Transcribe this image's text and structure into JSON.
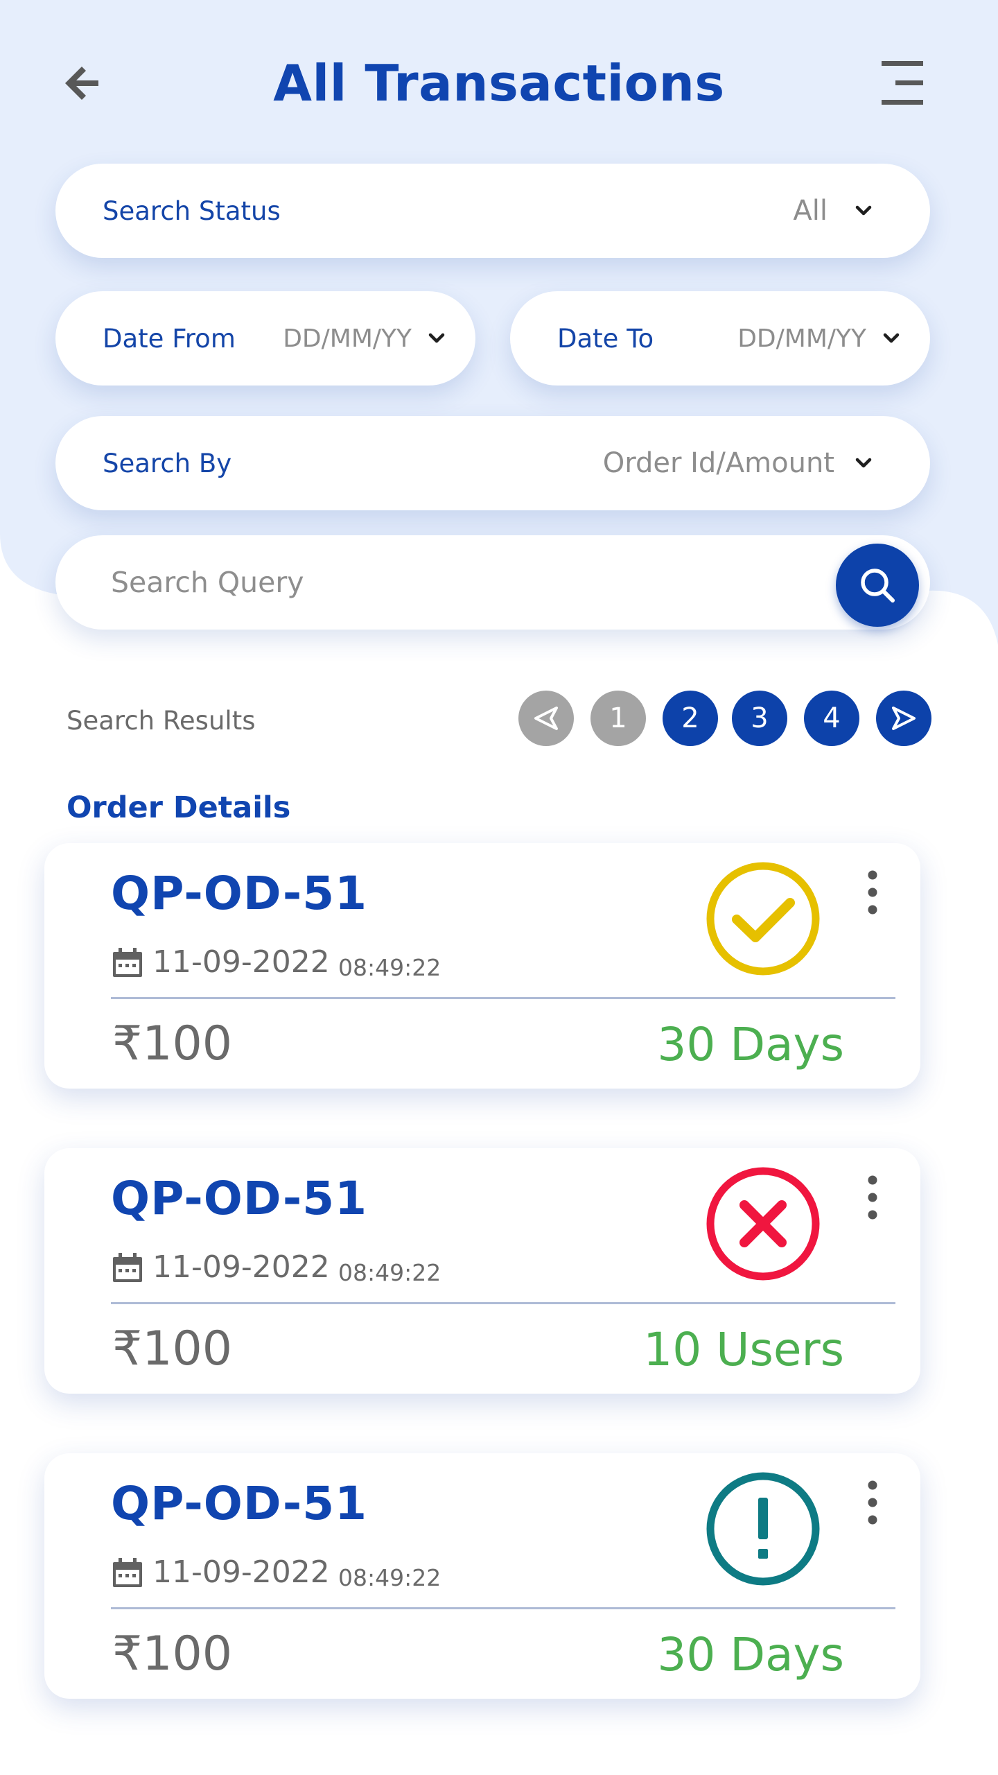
{
  "header": {
    "title": "All Transactions"
  },
  "filters": {
    "status": {
      "label": "Search Status",
      "value": "All"
    },
    "date_from": {
      "label": "Date From",
      "value": "DD/MM/YY"
    },
    "date_to": {
      "label": "Date To",
      "value": "DD/MM/YY"
    },
    "search_by": {
      "label": "Search By",
      "value": "Order Id/Amount"
    },
    "query": {
      "placeholder": "Search Query"
    }
  },
  "results": {
    "label": "Search Results",
    "pages": [
      "1",
      "2",
      "3",
      "4"
    ],
    "current_page": "1"
  },
  "section_title": "Order Details",
  "orders": [
    {
      "order_id": "QP-OD-51",
      "date": "11-09-2022",
      "time": "08:49:22",
      "amount": "₹100",
      "meta": "30 Days",
      "status_icon": "check-circle-icon",
      "status_color": "#e6c000"
    },
    {
      "order_id": "QP-OD-51",
      "date": "11-09-2022",
      "time": "08:49:22",
      "amount": "₹100",
      "meta": "10 Users",
      "status_icon": "x-circle-icon",
      "status_color": "#f0163f"
    },
    {
      "order_id": "QP-OD-51",
      "date": "11-09-2022",
      "time": "08:49:22",
      "amount": "₹100",
      "meta": "30 Days",
      "status_icon": "exclamation-circle-icon",
      "status_color": "#0e7b84"
    }
  ],
  "colors": {
    "brand_blue": "#0d42aa",
    "title_blue": "#1045b0",
    "success_green": "#4caf50",
    "background_tint": "#e6eefc"
  }
}
